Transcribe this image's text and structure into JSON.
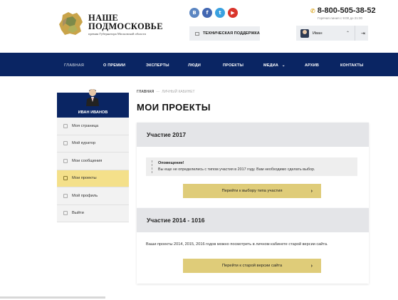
{
  "header": {
    "logo_title": "НАШЕ ПОДМОСКОВЬЕ",
    "logo_subtitle": "премия Губернатора Московской области",
    "socials": [
      {
        "name": "vk",
        "glyph": "В"
      },
      {
        "name": "facebook",
        "glyph": "f"
      },
      {
        "name": "twitter",
        "glyph": "t"
      },
      {
        "name": "youtube",
        "glyph": "▶"
      }
    ],
    "support_label": "ТЕХНИЧЕСКАЯ ПОДДЕРЖКА",
    "phone": "8-800-505-38-52",
    "phone_hours": "Горячая линия с 9:00 до 21:00",
    "user_name": "Иван"
  },
  "nav": {
    "items": [
      "ГЛАВНАЯ",
      "О ПРЕМИИ",
      "ЭКСПЕРТЫ",
      "ЛЮДИ",
      "ПРОЕКТЫ",
      "МЕДИА",
      "АРХИВ",
      "КОНТАКТЫ"
    ]
  },
  "sidebar": {
    "user_name": "ИВАН ИВАНОВ",
    "items": [
      "Моя страница",
      "Мой куратор",
      "Мои сообщения",
      "Мои проекты",
      "Мой профиль",
      "Выйти"
    ],
    "active_index": 3
  },
  "breadcrumbs": {
    "home": "ГЛАВНАЯ",
    "separator": "—",
    "current": "ЛИЧНЫЙ КАБИНЕТ"
  },
  "page_title": "МОИ ПРОЕКТЫ",
  "panels": {
    "p2017": {
      "title": "Участие 2017",
      "notice_title": "Оповещение!",
      "notice_text": "Вы еще не определились с типом участия в 2017 году. Вам необходимо сделать выбор.",
      "button": "Перейти к выбору типа участия"
    },
    "p2014": {
      "title": "Участие 2014 - 1016",
      "text": "Ваши проекты 2014, 2015, 2016 годов можно посмотреть в личном кабинете старой версии сайта.",
      "button": "Перейти к старой версии сайта"
    }
  },
  "colors": {
    "nav_bg": "#0a2563",
    "accent_yellow": "#dfcc79",
    "active_side": "#f4e08a"
  }
}
